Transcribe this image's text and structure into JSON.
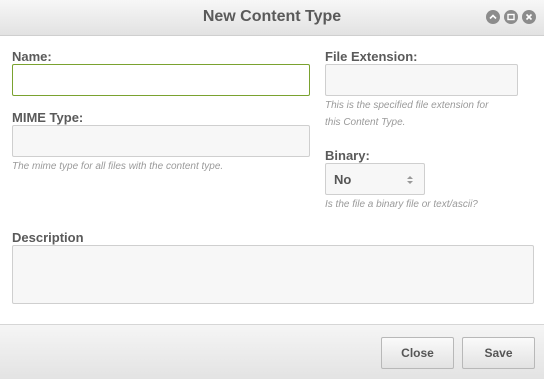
{
  "dialog": {
    "title": "New Content Type",
    "controls": {
      "minimize_icon": "chevron-up-icon",
      "maximize_icon": "maximize-icon",
      "close_icon": "close-icon"
    }
  },
  "form": {
    "name": {
      "label": "Name:",
      "value": ""
    },
    "mime_type": {
      "label": "MIME Type:",
      "value": "",
      "hint": "The mime type for all files with the content type."
    },
    "file_extension": {
      "label": "File Extension:",
      "value": "",
      "hint_line1": "This is the specified file extension for",
      "hint_line2": "this Content Type."
    },
    "binary": {
      "label": "Binary:",
      "selected": "No",
      "hint": "Is the file a binary file or text/ascii?"
    },
    "description": {
      "label": "Description",
      "value": ""
    }
  },
  "footer": {
    "close_label": "Close",
    "save_label": "Save"
  },
  "colors": {
    "focus_border": "#7aa22f",
    "title_text": "#5a5a5a"
  }
}
